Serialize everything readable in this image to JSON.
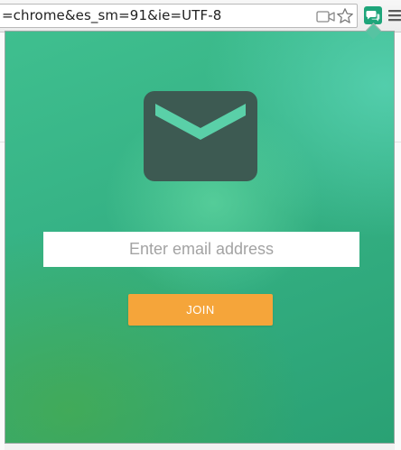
{
  "browser": {
    "url_fragment": "=chrome&es_sm=91&ie=UTF-8",
    "icons": {
      "camera": "video-camera-icon",
      "bookmark": "star-icon",
      "extension": "chat-bubbles-icon",
      "menu": "hamburger-menu-icon"
    }
  },
  "popup": {
    "icon": "envelope-icon",
    "email_placeholder": "Enter email address",
    "email_value": "",
    "join_label": "JOIN",
    "colors": {
      "background": "#35b184",
      "envelope_body": "#3d5a52",
      "envelope_flap": "#5ad0a8",
      "button": "#f5a53a",
      "button_text": "#ffffff"
    }
  }
}
